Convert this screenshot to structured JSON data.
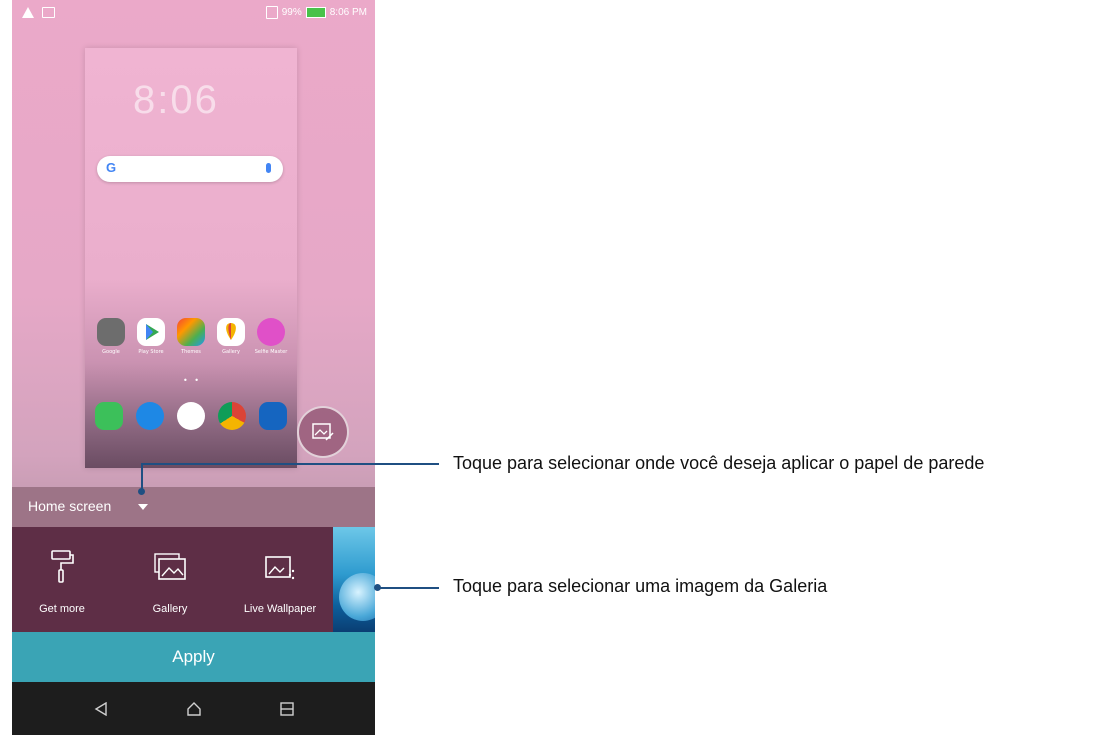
{
  "status_bar": {
    "battery": "99%",
    "battery_badge": "",
    "time": "8:06 PM"
  },
  "preview": {
    "clock": "8:06",
    "date": "",
    "search_g": "G",
    "apps": [
      {
        "label": "Google",
        "color": "#6d6d6d"
      },
      {
        "label": "Play Store",
        "color": "#ffffff"
      },
      {
        "label": "Themes",
        "color": "#f49b2a"
      },
      {
        "label": "Gallery",
        "color": "#ffffff"
      },
      {
        "label": "Selfie Master",
        "color": "#e050c8"
      }
    ],
    "dock": [
      {
        "name": "phone",
        "color": "#3cc05a"
      },
      {
        "name": "messages",
        "color": "#1e88e5"
      },
      {
        "name": "apps",
        "color": "#ffffff"
      },
      {
        "name": "chrome",
        "color": "#ffffff"
      },
      {
        "name": "camera",
        "color": "#1565c0"
      }
    ]
  },
  "selector": {
    "label": "Home screen"
  },
  "tray": {
    "items": [
      {
        "label": "Get more"
      },
      {
        "label": "Gallery"
      },
      {
        "label": "Live Wallpaper"
      }
    ]
  },
  "apply": {
    "label": "Apply"
  },
  "callouts": {
    "top": "Toque para selecionar onde você deseja aplicar o papel de parede",
    "bottom": "Toque para selecionar uma imagem da Galeria"
  },
  "colors": {
    "accent": "#3aa4b5",
    "callout_line": "#1f4f82",
    "tray": "#5e2e46"
  }
}
